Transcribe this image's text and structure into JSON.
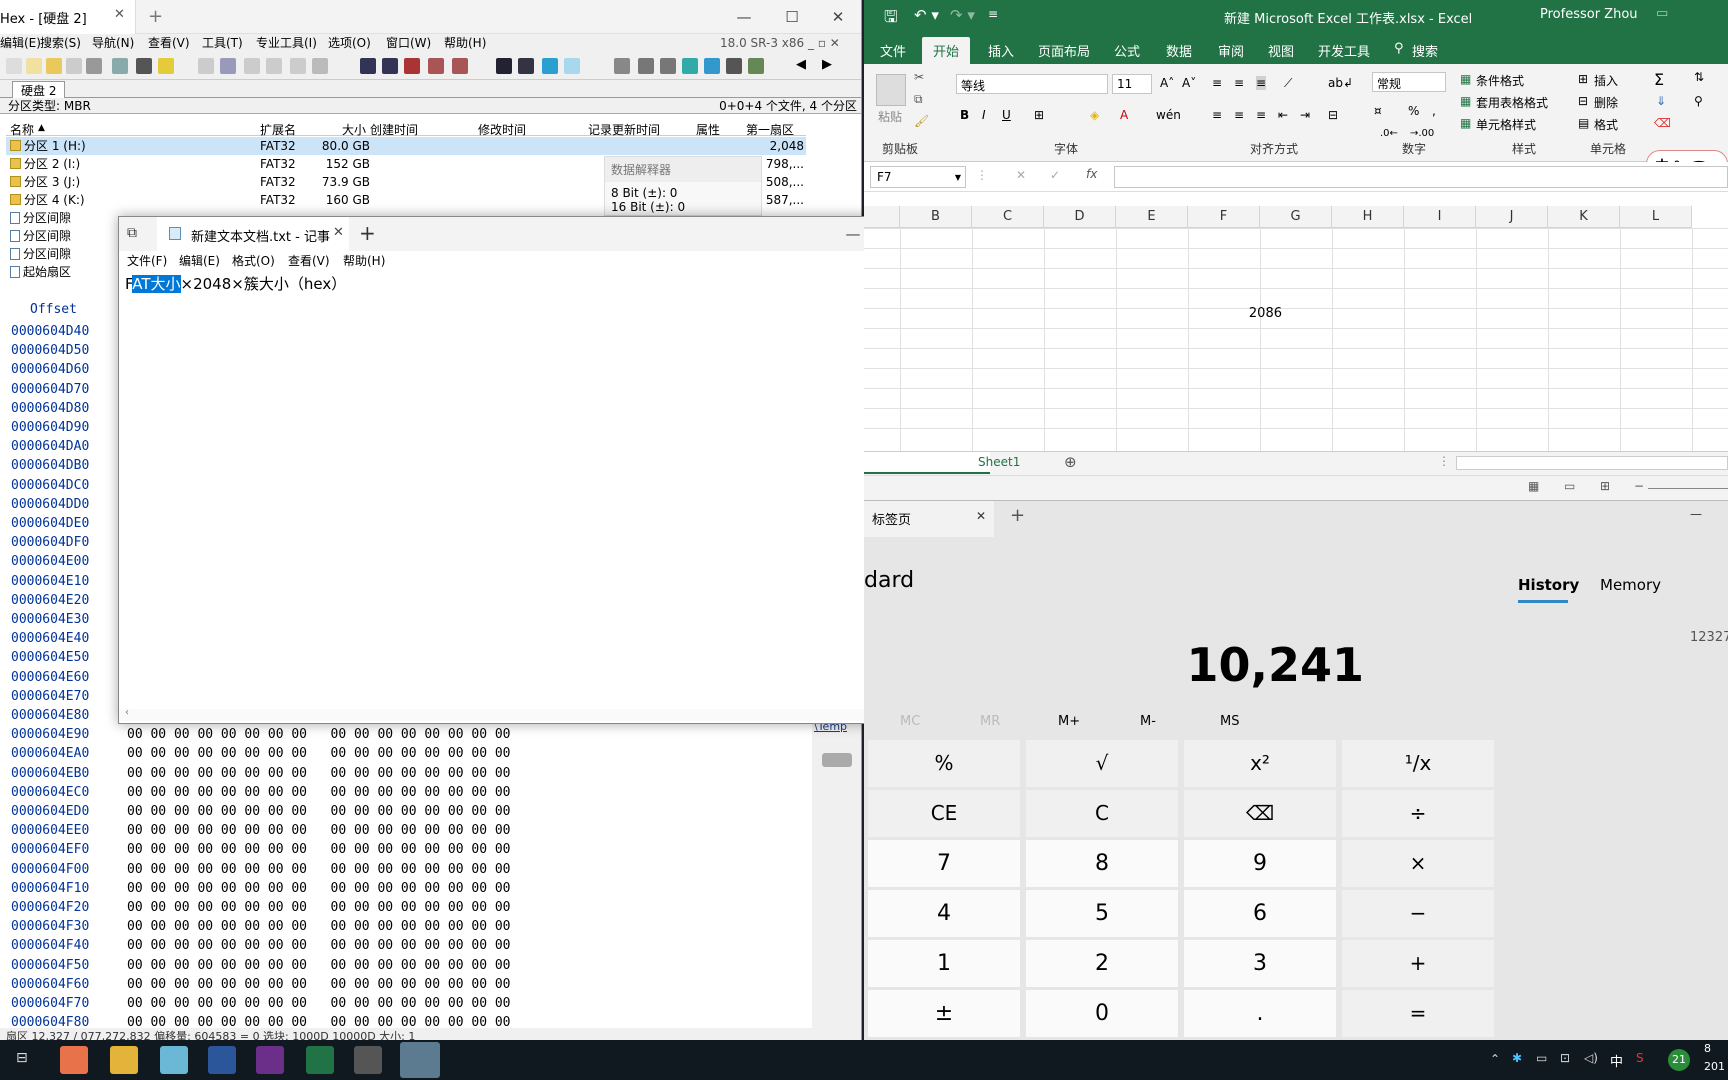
{
  "hex": {
    "title": "Hex - [硬盘 2]",
    "version": "18.0 SR-3 x86",
    "menu": [
      "编辑(E)",
      "搜索(S)",
      "导航(N)",
      "查看(V)",
      "工具(T)",
      "专业工具(I)",
      "选项(O)",
      "窗口(W)",
      "帮助(H)"
    ],
    "disk_tab": "硬盘 2",
    "info_left": "分区类型: MBR",
    "info_right": "0+0+4 个文件, 4 个分区",
    "columns": [
      "名称",
      "扩展名",
      "大小",
      "创建时间",
      "修改时间",
      "记录更新时间",
      "属性",
      "第一扇区"
    ],
    "partitions": [
      {
        "name": "分区 1 (H:)",
        "ext": "FAT32",
        "size": "80.0 GB",
        "first": "2,048",
        "selected": true
      },
      {
        "name": "分区 2 (I:)",
        "ext": "FAT32",
        "size": "152 GB",
        "first": "798,..."
      },
      {
        "name": "分区 3 (J:)",
        "ext": "FAT32",
        "size": "73.9 GB",
        "first": "508,..."
      },
      {
        "name": "分区 4 (K:)",
        "ext": "FAT32",
        "size": "160 GB",
        "first": "587,..."
      },
      {
        "name": "分区间隙",
        "ext": "",
        "size": "",
        "first": ""
      },
      {
        "name": "分区间隙",
        "ext": "",
        "size": "",
        "first": ""
      },
      {
        "name": "分区间隙",
        "ext": "",
        "size": "",
        "first": ""
      },
      {
        "name": "起始扇区",
        "ext": "",
        "size": "",
        "first": ""
      }
    ],
    "interpreter": {
      "title": "数据解释器",
      "bit8": "8 Bit (±): 0",
      "bit16": "16 Bit (±): 0"
    },
    "offset_header": "Offset",
    "offsets": [
      "0000604D40",
      "0000604D50",
      "0000604D60",
      "0000604D70",
      "0000604D80",
      "0000604D90",
      "0000604DA0",
      "0000604DB0",
      "0000604DC0",
      "0000604DD0",
      "0000604DE0",
      "0000604DF0",
      "0000604E00",
      "0000604E10",
      "0000604E20",
      "0000604E30",
      "0000604E40",
      "0000604E50",
      "0000604E60",
      "0000604E70",
      "0000604E80",
      "0000604E90",
      "0000604EA0",
      "0000604EB0",
      "0000604EC0",
      "0000604ED0",
      "0000604EE0",
      "0000604EF0",
      "0000604F00",
      "0000604F10",
      "0000604F20",
      "0000604F30",
      "0000604F40",
      "0000604F50",
      "0000604F60",
      "0000604F70",
      "0000604F80"
    ],
    "byte_row": "00 00 00 00 00 00 00 00   00 00 00 00 00 00 00 00",
    "side_path": "\\Temp",
    "status": "扇区 12,327 / 077,272,832          偏移量:                604583               = 0  选块:              1000D  10000D  大小:                 1"
  },
  "notepad": {
    "title": "新建文本文档.txt - 记事",
    "menu": [
      "文件(F)",
      "编辑(E)",
      "格式(O)",
      "查看(V)",
      "帮助(H)"
    ],
    "text_pre": "F",
    "text_sel": "AT大小",
    "text_post": "×2048×簇大小（hex）"
  },
  "excel": {
    "title": "新建 Microsoft Excel 工作表.xlsx  -  Excel",
    "user": "Professor Zhou",
    "tabs": [
      "文件",
      "开始",
      "插入",
      "页面布局",
      "公式",
      "数据",
      "审阅",
      "视图",
      "开发工具"
    ],
    "search": "搜索",
    "font": "等线",
    "font_size": "11",
    "number_format": "常规",
    "styles": [
      "条件格式",
      "套用表格格式",
      "单元格样式"
    ],
    "cells_btns": [
      "插入",
      "删除",
      "格式"
    ],
    "groups": [
      "剪贴板",
      "字体",
      "对齐方式",
      "数字",
      "样式",
      "单元格"
    ],
    "paste": "粘贴",
    "name_box": "F7",
    "columns": [
      "B",
      "C",
      "D",
      "E",
      "F",
      "G",
      "H",
      "I",
      "J",
      "K",
      "L"
    ],
    "cell_e": "2086",
    "sheet": "Sheet1",
    "ime": "中"
  },
  "calc": {
    "tab_title": "标签页",
    "mode": "dard",
    "history": "History",
    "memory": "Memory",
    "history_value": "12327",
    "display": "10,241",
    "mem_row": [
      "MC",
      "MR",
      "M+",
      "M-",
      "MS"
    ],
    "keys": [
      [
        "%",
        "√",
        "x²",
        "¹/x"
      ],
      [
        "CE",
        "C",
        "⌫",
        "÷"
      ],
      [
        "7",
        "8",
        "9",
        "×"
      ],
      [
        "4",
        "5",
        "6",
        "−"
      ],
      [
        "1",
        "2",
        "3",
        "+"
      ],
      [
        "±",
        "0",
        ".",
        "="
      ]
    ]
  },
  "taskbar": {
    "time": "8",
    "date": "201",
    "ime": "中",
    "badge": "21"
  }
}
